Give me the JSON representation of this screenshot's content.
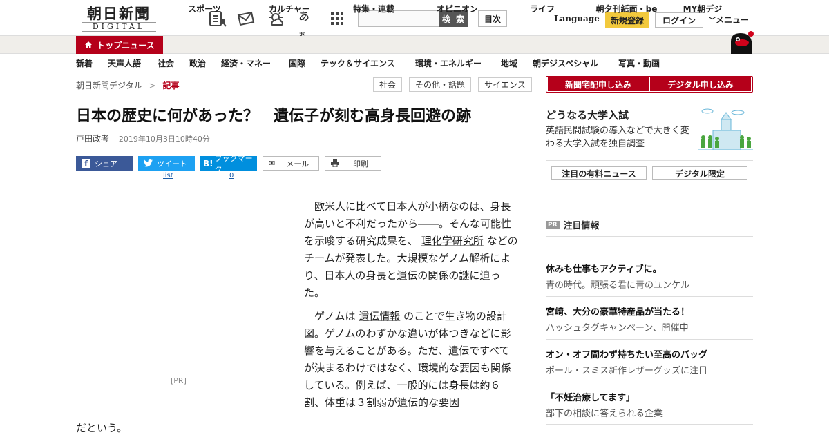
{
  "header": {
    "logo_main": "朝日新聞",
    "logo_sub": "DIGITAL",
    "icons": [
      "newspaper-icon",
      "mail-icon",
      "weather-icon",
      "font-size-icon",
      "grid-menu-icon"
    ],
    "font_size_glyph": "あ",
    "font_size_glyph_small": "あ",
    "search_button": "検 索",
    "toc_button": "目次",
    "language": "Language",
    "register": "新規登録",
    "login": "ログイン",
    "menu": "メニュー"
  },
  "nav_primary": [
    {
      "label": "トップニュース",
      "active": true
    },
    {
      "label": "スポーツ"
    },
    {
      "label": "カルチャー"
    },
    {
      "label": "特集・連載"
    },
    {
      "label": "オピニオン"
    },
    {
      "label": "ライフ"
    },
    {
      "label": "朝夕刊紙面・be"
    },
    {
      "label": "MY朝デジ"
    }
  ],
  "nav_secondary": [
    "社会",
    "天声人語",
    "社会",
    "政治",
    "経済・マネー",
    "国際",
    "テック＆サイエンス",
    "環境・エネルギー",
    "地域",
    "朝デジスペシャル",
    "写真・動画"
  ],
  "breadcrumb": {
    "site": "朝日新聞デジタル",
    "sep": ">",
    "current": "記事"
  },
  "category_tags": [
    "社会",
    "その他・話題",
    "サイエンス"
  ],
  "article": {
    "title": "日本の歴史に何があった？　遺伝子が刻む高身長回避の跡",
    "author": "戸田政考",
    "date": "2019年10月3日10時40分",
    "share": {
      "facebook": "シェア",
      "twitter": "ツイート",
      "twitter_count": "list",
      "hatena": "ブックマーク",
      "hatena_count": "0",
      "mail": "メール",
      "print": "印刷"
    },
    "pr_label": "[PR]",
    "p1_a": "欧米人に比べて日本人が小柄なのは、身長が高いと不利だったから――。そんな可能性を示唆する研究成果を、",
    "p1_link": "理化学研究所",
    "p1_b": "などのチームが発表した。大規模なゲノム解析により、日本人の身長と遺伝の関係の謎に迫った。",
    "p2_a": "ゲノムは",
    "p2_link": "遺伝情報",
    "p2_b": "のことで生き物の設計図。ゲノムのわずかな違いが体つきなどに影響を与えることがある。ただ、遺伝ですべてが決まるわけではなく、環境的な要因も関係している。例えば、一般的には身長は約６割、体重は３割弱が遺伝的な要因",
    "p2_tail": "だという。"
  },
  "sidebar": {
    "subscribe_paper": "新聞宅配申し込み",
    "subscribe_digital": "デジタル申し込み",
    "feature_title": "どうなる大学入試",
    "feature_desc": "英語民間試験の導入などで大きく変わる大学入試を独自調査",
    "btn_paid_news": "注目の有料ニュース",
    "btn_digital_only": "デジタル限定",
    "pr_badge": "PR",
    "pr_heading": "注目情報",
    "ads": [
      {
        "title": "休みも仕事もアクティブに。",
        "desc": "青の時代。頑張る君に青のユンケル"
      },
      {
        "title": "宮崎、大分の豪華特産品が当たる！",
        "desc": "ハッシュタグキャンペーン、開催中"
      },
      {
        "title": "オン・オフ問わず持ちたい至高のバッグ",
        "desc": "ポール・スミス新作レザーグッズに注目"
      },
      {
        "title": "「不妊治療してます」",
        "desc": "部下の相談に答えられる企業"
      }
    ]
  },
  "colors": {
    "brand_red": "#b5001a",
    "register_yellow": "#f2c93d",
    "facebook": "#3b5998",
    "twitter": "#1da1f2",
    "hatena": "#008fde"
  }
}
